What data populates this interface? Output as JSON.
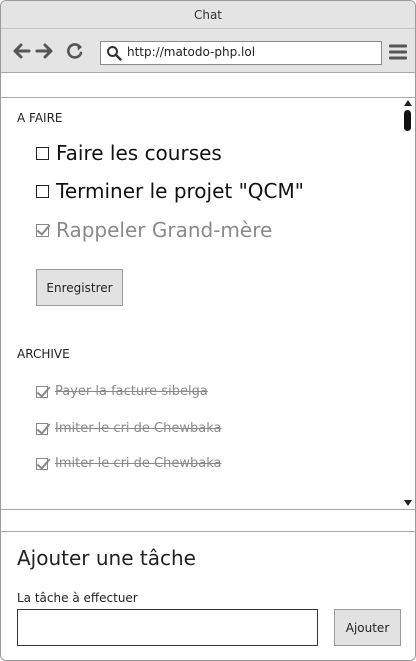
{
  "window": {
    "title": "Chat"
  },
  "toolbar": {
    "url": "http://matodo-php.lol"
  },
  "todo": {
    "heading": "A FAIRE",
    "items": [
      {
        "label": "Faire les courses",
        "checked": false
      },
      {
        "label": "Terminer le projet \"QCM\"",
        "checked": false
      },
      {
        "label": "Rappeler Grand-mère",
        "checked": true
      }
    ],
    "save_label": "Enregistrer"
  },
  "archive": {
    "heading": "ARCHIVE",
    "items": [
      {
        "label": "Payer la facture sibelga",
        "checked": true
      },
      {
        "label": "Imiter le cri de Chewbaka",
        "checked": true
      },
      {
        "label": "Imiter le cri de Chewbaka",
        "checked": true
      }
    ]
  },
  "add_task": {
    "title": "Ajouter une tâche",
    "field_label": "La tâche à effectuer",
    "input_value": "",
    "submit_label": "Ajouter"
  }
}
